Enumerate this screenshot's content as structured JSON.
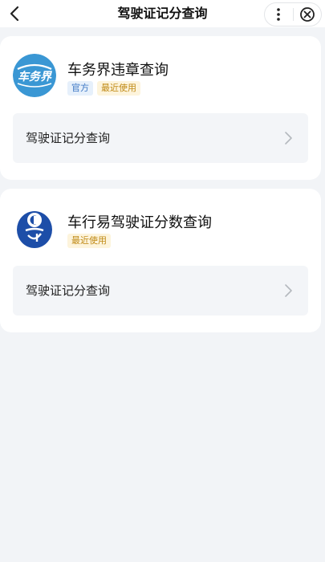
{
  "header": {
    "title": "驾驶证记分查询",
    "back_icon": "chevron-left-icon",
    "more_icon": "more-vertical-icon",
    "close_icon": "close-circle-icon"
  },
  "results": [
    {
      "name": "车务界违章查询",
      "logo_text": "车务界",
      "logo_color": "#3a97d4",
      "tags": {
        "official": "官方",
        "recent": "最近使用"
      },
      "service": "驾驶证记分查询"
    },
    {
      "name": "车行易驾驶证分数查询",
      "logo_color": "#1d4ea8",
      "tags": {
        "recent": "最近使用"
      },
      "service": "驾驶证记分查询"
    }
  ],
  "colors": {
    "page_bg": "#f2f4f7",
    "tag_official_bg": "#e6f0fb",
    "tag_recent_bg": "#fdf4dc"
  }
}
